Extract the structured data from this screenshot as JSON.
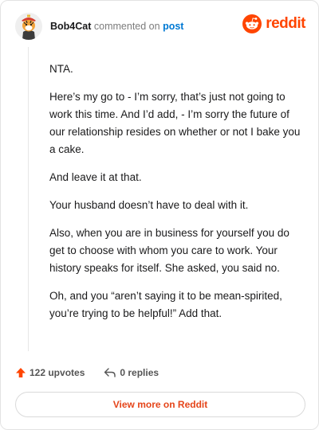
{
  "header": {
    "username": "Bob4Cat",
    "verb": "commented on",
    "post_link": "post",
    "logo_text": "reddit"
  },
  "comment": {
    "paragraphs": [
      "NTA.",
      "Here’s my go to - I’m sorry, that’s just not going to work this time. And I’d add, - I’m sorry the future of our relationship resides on whether or not I bake you a cake.",
      "And leave it at that.",
      "Your husband doesn’t have to deal with it.",
      "Also, when you are in business for yourself you do get to choose with whom you care to work. Your history speaks for itself. She asked, you said no.",
      "Oh, and you “aren’t saying it to be mean-spirited, you’re trying to be helpful!” Add that."
    ]
  },
  "footer": {
    "upvotes": "122 upvotes",
    "replies": "0 replies",
    "view_more": "View more on Reddit"
  },
  "colors": {
    "brand": "#ff4500",
    "link": "#0079d3",
    "upvote": "#ff4500"
  },
  "icons": {
    "avatar": "tiger-avatar",
    "logo": "reddit-snoo-icon",
    "upvote": "upvote-arrow-icon",
    "reply": "reply-arrow-icon"
  }
}
